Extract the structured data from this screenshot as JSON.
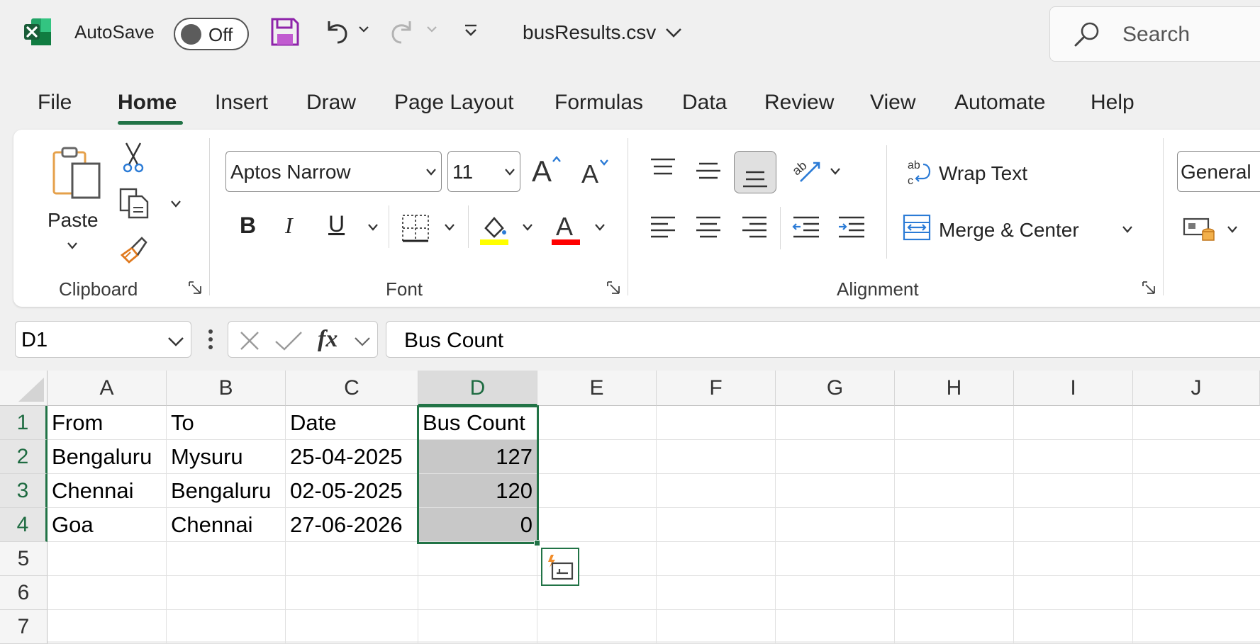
{
  "titlebar": {
    "autosave_label": "AutoSave",
    "autosave_state": "Off",
    "file_name": "busResults.csv",
    "search_placeholder": "Search"
  },
  "tabs": [
    {
      "label": "File"
    },
    {
      "label": "Home",
      "active": true
    },
    {
      "label": "Insert"
    },
    {
      "label": "Draw"
    },
    {
      "label": "Page Layout"
    },
    {
      "label": "Formulas"
    },
    {
      "label": "Data"
    },
    {
      "label": "Review"
    },
    {
      "label": "View"
    },
    {
      "label": "Automate"
    },
    {
      "label": "Help"
    }
  ],
  "ribbon": {
    "clipboard": {
      "paste_label": "Paste",
      "group_label": "Clipboard"
    },
    "font": {
      "font_name": "Aptos Narrow",
      "font_size": "11",
      "group_label": "Font",
      "highlight_color": "#ffff00",
      "font_color": "#ff0000"
    },
    "alignment": {
      "wrap_text_label": "Wrap Text",
      "merge_center_label": "Merge & Center",
      "group_label": "Alignment"
    },
    "number": {
      "format": "General"
    }
  },
  "formula_bar": {
    "name_box": "D1",
    "fx_label": "fx",
    "formula": "Bus Count"
  },
  "sheet": {
    "columns": [
      "A",
      "B",
      "C",
      "D",
      "E",
      "F",
      "G",
      "H",
      "I",
      "J"
    ],
    "rows": [
      "1",
      "2",
      "3",
      "4",
      "5",
      "6",
      "7"
    ],
    "cells": [
      [
        "From",
        "To",
        "Date",
        "Bus Count"
      ],
      [
        "Bengaluru",
        "Mysuru",
        "25-04-2025",
        "127"
      ],
      [
        "Chennai",
        "Bengaluru",
        "02-05-2025",
        "120"
      ],
      [
        "Goa",
        "Chennai",
        "27-06-2026",
        "0"
      ]
    ],
    "selected_range": "D1:D4",
    "accent_color": "#217346"
  }
}
